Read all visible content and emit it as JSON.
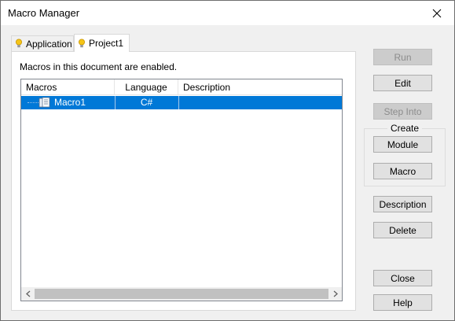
{
  "window": {
    "title": "Macro Manager"
  },
  "tabs": [
    {
      "label": "Application",
      "icon": "lightbulb-icon",
      "selected": false
    },
    {
      "label": "Project1",
      "icon": "lightbulb-icon",
      "selected": true
    }
  ],
  "panel": {
    "status": "Macros in this document are enabled."
  },
  "table": {
    "columns": [
      "Macros",
      "Language",
      "Description"
    ],
    "rows": [
      {
        "name": "Macro1",
        "language": "C#",
        "description": "",
        "selected": true
      }
    ]
  },
  "buttons": {
    "run": "Run",
    "edit": "Edit",
    "step_into": "Step Into",
    "create_group": "Create",
    "module": "Module",
    "macro": "Macro",
    "description": "Description",
    "delete": "Delete",
    "close": "Close",
    "help": "Help"
  },
  "colors": {
    "selection": "#0078d7",
    "window_bg": "#f0f0f0",
    "disabled_text": "#8c8c8c"
  }
}
